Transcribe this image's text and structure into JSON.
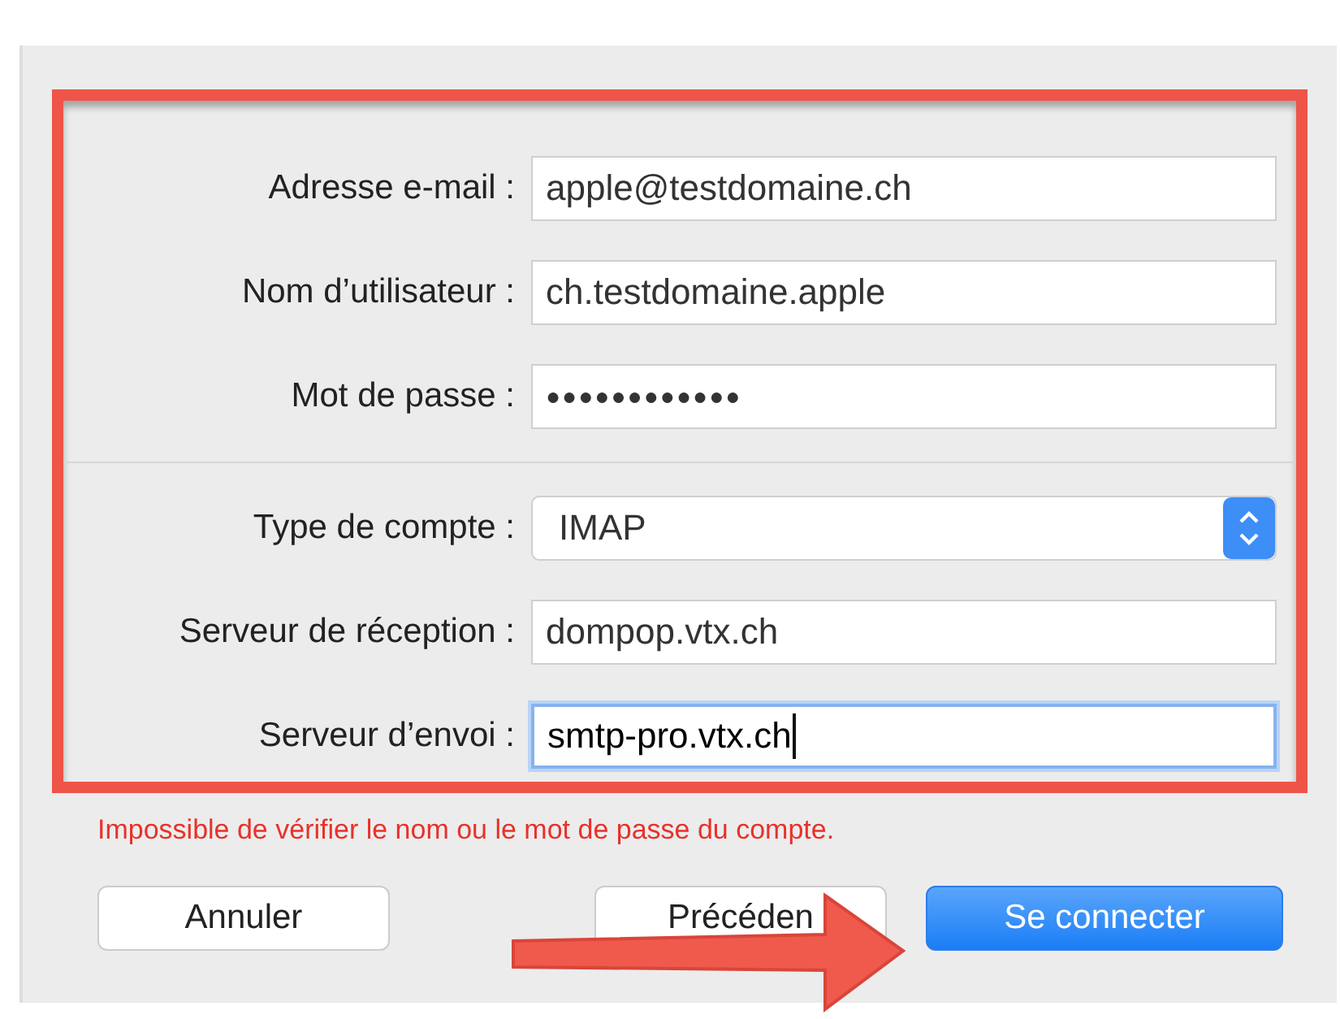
{
  "account_fields": [
    {
      "label": "Adresse e-mail :",
      "value": "apple@testdomaine.ch",
      "kind": "text",
      "focused": false
    },
    {
      "label": "Nom d’utilisateur :",
      "value": "ch.testdomaine.apple",
      "kind": "text",
      "focused": false
    },
    {
      "label": "Mot de passe :",
      "value": "●●●●●●●●●●●●",
      "kind": "password",
      "focused": false
    }
  ],
  "server_fields": [
    {
      "label": "Type de compte :",
      "value": "IMAP",
      "kind": "popup",
      "focused": false
    },
    {
      "label": "Serveur de réception :",
      "value": "dompop.vtx.ch",
      "kind": "text",
      "focused": false
    },
    {
      "label": "Serveur d’envoi :",
      "value": "smtp-pro.vtx.ch",
      "kind": "text",
      "focused": true
    }
  ],
  "error": "Impossible de vérifier le nom ou le mot de passe du compte.",
  "buttons": [
    {
      "label": "Annuler",
      "kind": "default"
    },
    {
      "label": "Précéden",
      "kind": "default"
    },
    {
      "label": "Se connecter",
      "kind": "primary"
    }
  ]
}
